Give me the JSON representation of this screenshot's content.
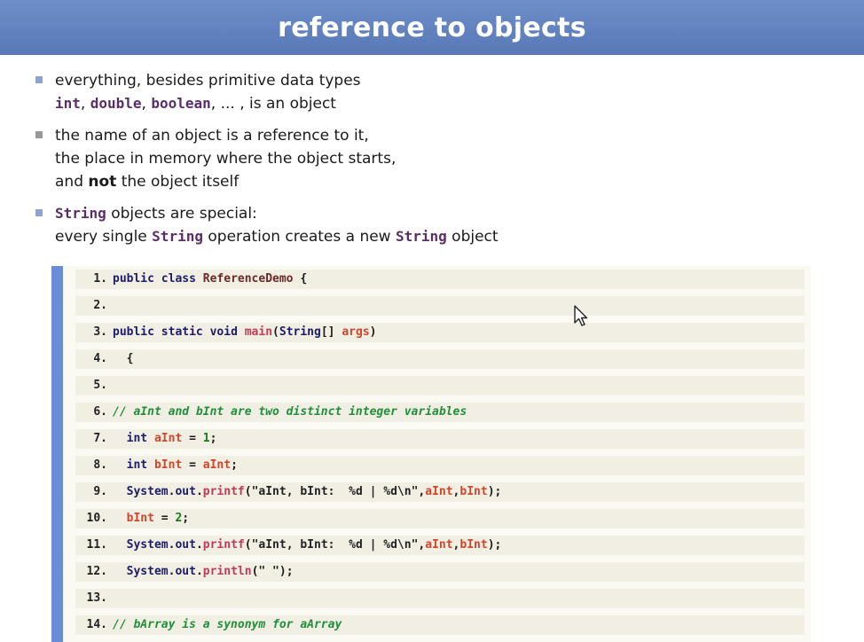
{
  "slide": {
    "title": "reference to objects"
  },
  "bullets": {
    "b1_line1": "everything, besides primitive data types",
    "b1_kw1": "int",
    "b1_sep1": ", ",
    "b1_kw2": "double",
    "b1_sep2": ", ",
    "b1_kw3": "boolean",
    "b1_rest": ", ... , is an object",
    "b2_line1": "the name of an object is a reference to it,",
    "b2_line2": "the place in memory where the object starts,",
    "b2_line3a": "and ",
    "b2_line3b": "not",
    "b2_line3c": " the object itself",
    "b3_kw": "String",
    "b3_line1": " objects are special:",
    "b3_line2a": "every single ",
    "b3_kw2": "String",
    "b3_line2b": " operation creates a new ",
    "b3_kw3": "String",
    "b3_line2c": " object"
  },
  "code": {
    "lines": [
      {
        "n": "1.",
        "t": "public class ReferenceDemo {"
      },
      {
        "n": "2.",
        "t": ""
      },
      {
        "n": "3.",
        "t": "public static void main(String[] args)"
      },
      {
        "n": "4.",
        "t": "  {"
      },
      {
        "n": "5.",
        "t": ""
      },
      {
        "n": "6.",
        "t": "// aInt and bInt are two distinct integer variables"
      },
      {
        "n": "7.",
        "t": "  int aInt = 1;"
      },
      {
        "n": "8.",
        "t": "  int bInt = aInt;"
      },
      {
        "n": "9.",
        "t": "  System.out.printf(\"aInt, bInt:  %d | %d\\n\",aInt,bInt);"
      },
      {
        "n": "10.",
        "t": "  bInt = 2;"
      },
      {
        "n": "11.",
        "t": "  System.out.printf(\"aInt, bInt:  %d | %d\\n\",aInt,bInt);"
      },
      {
        "n": "12.",
        "t": "  System.out.println(\" \");"
      },
      {
        "n": "13.",
        "t": ""
      },
      {
        "n": "14.",
        "t": "// bArray is a synonym for aArray"
      }
    ]
  },
  "colors": {
    "title_bar": "#5878b6",
    "code_bar": "#6b8cd6",
    "keyword": "#5a2d6b"
  }
}
